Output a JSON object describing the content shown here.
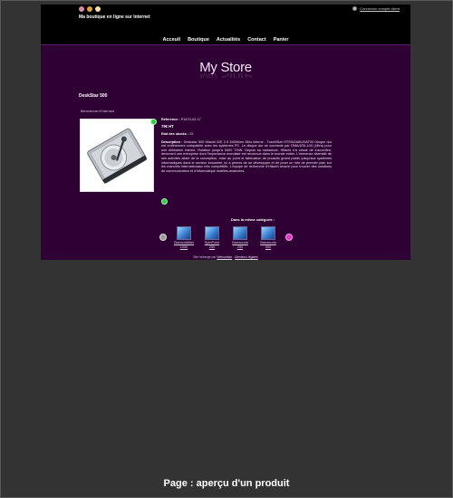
{
  "site": {
    "tagline": "Ma boutique en ligne sur Internet",
    "login_link": "Connexion compte client",
    "flag_colors": [
      "#d98aa8",
      "#e4a23a",
      "#f0e49a"
    ],
    "logo": "My Store",
    "accent": "#2e0033"
  },
  "nav": {
    "items": [
      {
        "label": "Acceuil"
      },
      {
        "label": "Boutique"
      },
      {
        "label": "Actualités"
      },
      {
        "label": "Contact"
      },
      {
        "label": "Panier"
      }
    ]
  },
  "product": {
    "title": "DeskStar 500",
    "category_link": "Bienvenue>Externes",
    "reference_label": "Reference :",
    "reference_value": "P1470-02-17",
    "price": "79€ HT",
    "stock_label": "Etat des stocks :",
    "stock_value": "22",
    "description_label": "Description :",
    "description_text": "Deskstar 500 Hitachi IDE 2.5 5400t/mn 8Mo interne - TravelStar HTS541680J9AT00 Disque dur est entièrement compatible avec les systèmes PC. Le disque dur se connecte par DMA/ATA-100 (Ultra) pour une utilisation interne. Rotation jusqu'à 5400 T/MN. Depuis sa naissance, Hitachi n'a cessé de s'accroître, devenant une entreprise dont l'importance mondiale est reconnue dans le monde entier. L'immense diversité de ses activités allant de la conception, mise au point et fabrication de produits grand public jusqu'aux systèmes informatiques dans le secteur industriel, lui a permis de se développer et de jouer un rôle de premier plan sur les marchés internationaux très compétitifs. L'équipe de recherche d'Hitachi œuvre pour trouver des solutions de communication et d'informatique mobiles avancées."
  },
  "related": {
    "title": "Dans la même catégorie :",
    "items": [
      {
        "name": "DiamondMax",
        "sub": "1000"
      },
      {
        "name": "SpinPoint",
        "sub": "250"
      },
      {
        "name": "Barracuda",
        "sub": "250"
      },
      {
        "name": "Barracuda",
        "sub": "500"
      }
    ]
  },
  "footer": {
    "prefix": "Site hébergé par",
    "link1": "Webcartise",
    "sep": " - ",
    "link2": "Mentions légales"
  },
  "caption": "Page : aperçu d'un produit"
}
